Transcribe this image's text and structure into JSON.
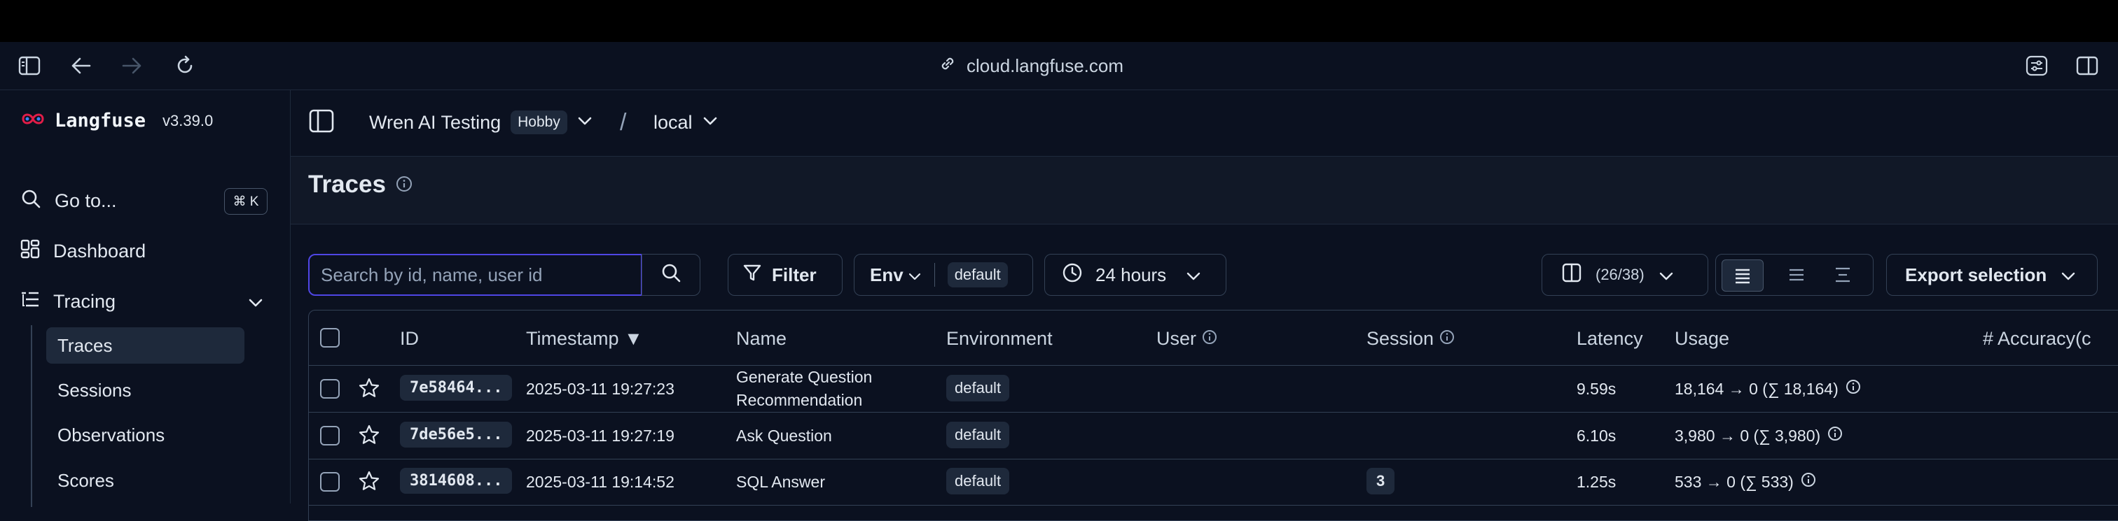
{
  "browser": {
    "url": "cloud.langfuse.com"
  },
  "sidebar": {
    "brand_name": "Langfuse",
    "version": "v3.39.0",
    "goto_label": "Go to...",
    "goto_shortcut": "⌘ K",
    "dashboard_label": "Dashboard",
    "tracing_label": "Tracing",
    "sub_items": [
      {
        "label": "Traces",
        "active": true
      },
      {
        "label": "Sessions",
        "active": false
      },
      {
        "label": "Observations",
        "active": false
      },
      {
        "label": "Scores",
        "active": false
      }
    ]
  },
  "header": {
    "project": "Wren AI Testing",
    "plan": "Hobby",
    "separator": "/",
    "environment": "local"
  },
  "page": {
    "title": "Traces"
  },
  "toolbar": {
    "search_placeholder": "Search by id, name, user id",
    "filter_label": "Filter",
    "env_label": "Env",
    "env_value": "default",
    "time_range": "24 hours",
    "columns_count": "(26/38)",
    "export_label": "Export selection"
  },
  "table": {
    "headers": {
      "id": "ID",
      "timestamp": "Timestamp ▼",
      "name": "Name",
      "environment": "Environment",
      "user": "User",
      "session": "Session",
      "latency": "Latency",
      "usage": "Usage",
      "accuracy": "# Accuracy(c"
    },
    "rows": [
      {
        "id": "7e58464...",
        "timestamp": "2025-03-11 19:27:23",
        "name_line1": "Generate Question",
        "name_line2": "Recommendation",
        "environment": "default",
        "session": "",
        "latency": "9.59s",
        "usage": "18,164 → 0 (∑ 18,164)"
      },
      {
        "id": "7de56e5...",
        "timestamp": "2025-03-11 19:27:19",
        "name_line1": "Ask Question",
        "name_line2": "",
        "environment": "default",
        "session": "",
        "latency": "6.10s",
        "usage": "3,980 → 0 (∑ 3,980)"
      },
      {
        "id": "3814608...",
        "timestamp": "2025-03-11 19:14:52",
        "name_line1": "SQL Answer",
        "name_line2": "",
        "environment": "default",
        "session": "3",
        "latency": "1.25s",
        "usage": "533 → 0 (∑ 533)"
      }
    ]
  }
}
